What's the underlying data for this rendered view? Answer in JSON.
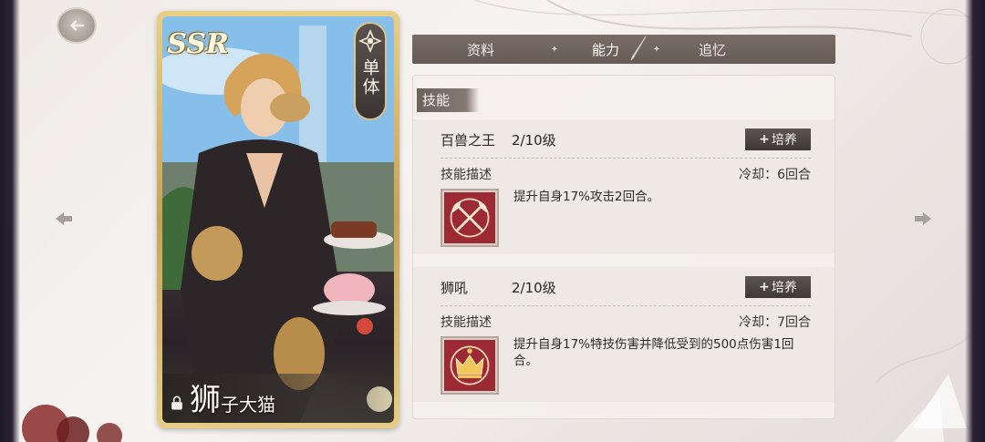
{
  "card": {
    "rarity": "SSR",
    "target_type": "单体",
    "name_first": "狮",
    "name_rest": "子大猫"
  },
  "tabs": [
    {
      "label": "资料",
      "active": false
    },
    {
      "label": "能力",
      "active": true
    },
    {
      "label": "追忆",
      "active": false
    }
  ],
  "panel": {
    "header": "技能",
    "skills": [
      {
        "name": "百兽之王",
        "level": "2/10级",
        "train_label": "培养",
        "desc_label": "技能描述",
        "cooldown": "冷却：6回合",
        "description": "提升自身17%攻击2回合。",
        "icon": "crossed-axes-icon"
      },
      {
        "name": "狮吼",
        "level": "2/10级",
        "train_label": "培养",
        "desc_label": "技能描述",
        "cooldown": "冷却：7回合",
        "description": "提升自身17%特技伤害并降低受到的500点伤害1回合。",
        "icon": "crown-icon"
      }
    ]
  },
  "colors": {
    "tab_bar": "#6f625d",
    "skill_icon_bg": "#9c2a34",
    "card_frame": "#d9bd74"
  }
}
